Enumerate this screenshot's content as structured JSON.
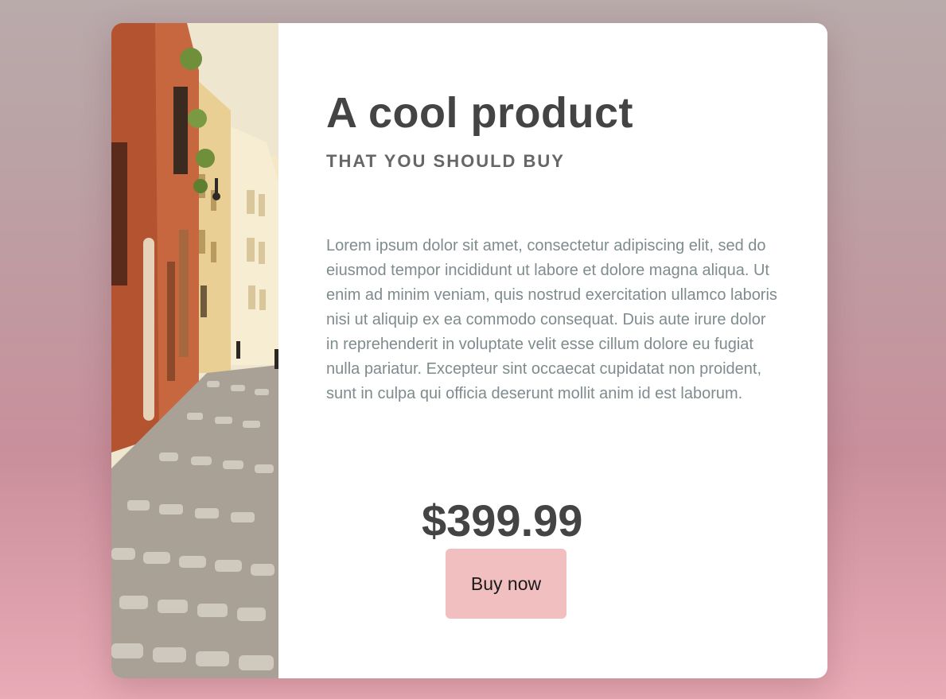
{
  "product": {
    "title": "A cool product",
    "subtitle": "THAT YOU SHOULD BUY",
    "description": "Lorem ipsum dolor sit amet, consectetur adipiscing elit, sed do eiusmod tempor incididunt ut labore et dolore magna aliqua. Ut enim ad minim veniam, quis nostrud exercitation ullamco laboris nisi ut aliquip ex ea commodo consequat. Duis aute irure dolor in reprehenderit in voluptate velit esse cillum dolore eu fugiat nulla pariatur. Excepteur sint occaecat cupidatat non proident, sunt in culpa qui officia deserunt mollit anim id est laborum.",
    "price": "$399.99",
    "buy_label": "Buy now",
    "image": "street-photo"
  },
  "colors": {
    "background_top": "#b9aaab",
    "background_bottom": "#e9abb6",
    "title_text": "#444444",
    "subtitle_text": "#666666",
    "body_text": "#7f8c8d",
    "button_bg": "#f2bfc0"
  }
}
